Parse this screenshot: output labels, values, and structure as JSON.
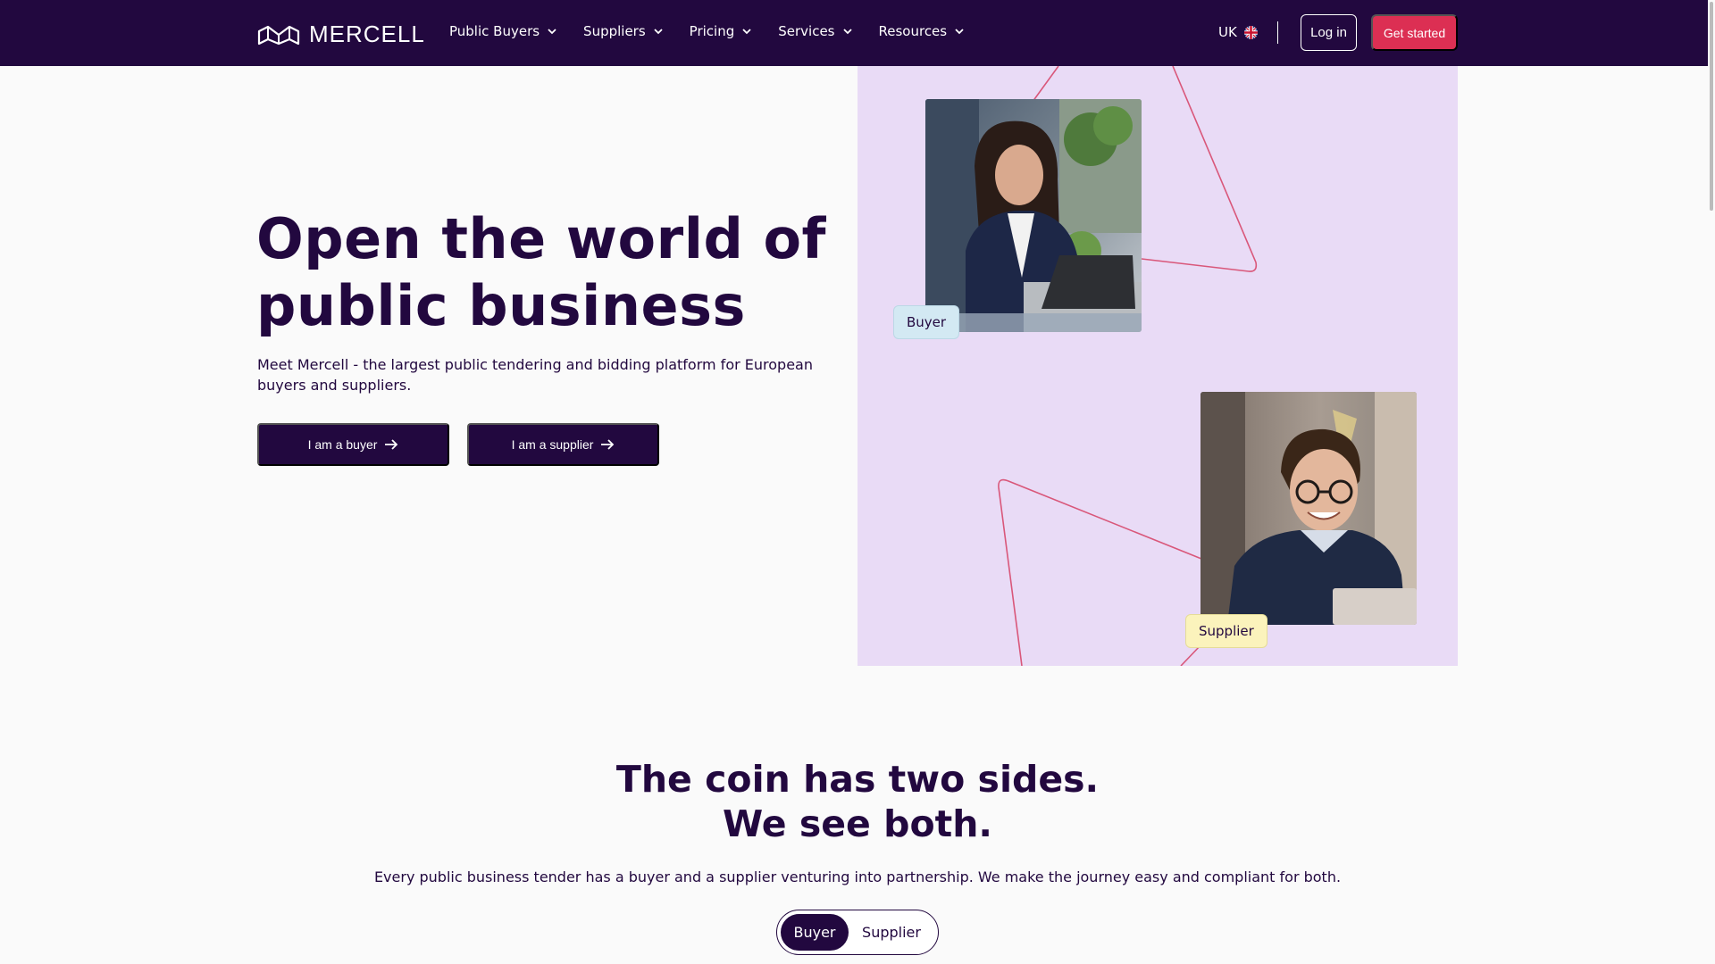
{
  "brand": {
    "name": "MERCELL",
    "logo_icon": "mercell-logo-icon"
  },
  "nav": {
    "items": [
      {
        "label": "Public Buyers"
      },
      {
        "label": "Suppliers"
      },
      {
        "label": "Pricing"
      },
      {
        "label": "Services"
      },
      {
        "label": "Resources"
      }
    ],
    "language": "UK",
    "login_label": "Log in",
    "cta_label": "Get started"
  },
  "hero": {
    "title_line1": "Open the world of",
    "title_line2": "public business",
    "subtitle": "Meet Mercell - the largest public tendering and bidding platform for European buyers and suppliers.",
    "buyer_button": "I am a buyer",
    "supplier_button": "I am a supplier",
    "buyer_tag": "Buyer",
    "supplier_tag": "Supplier"
  },
  "section": {
    "title_line1": "The coin has two sides.",
    "title_line2": "We see both.",
    "subtitle": "Every public business tender has a buyer and a supplier venturing into partnership. We make the journey easy and compliant for both.",
    "toggle": {
      "active": "Buyer",
      "inactive": "Supplier"
    }
  },
  "colors": {
    "primary": "#22083f",
    "accent": "#dc2f53",
    "hero_panel": "#e9dbf6",
    "buyer_tag": "#d3e9f3",
    "supplier_tag": "#fbf3bc",
    "line": "#d9577a"
  }
}
